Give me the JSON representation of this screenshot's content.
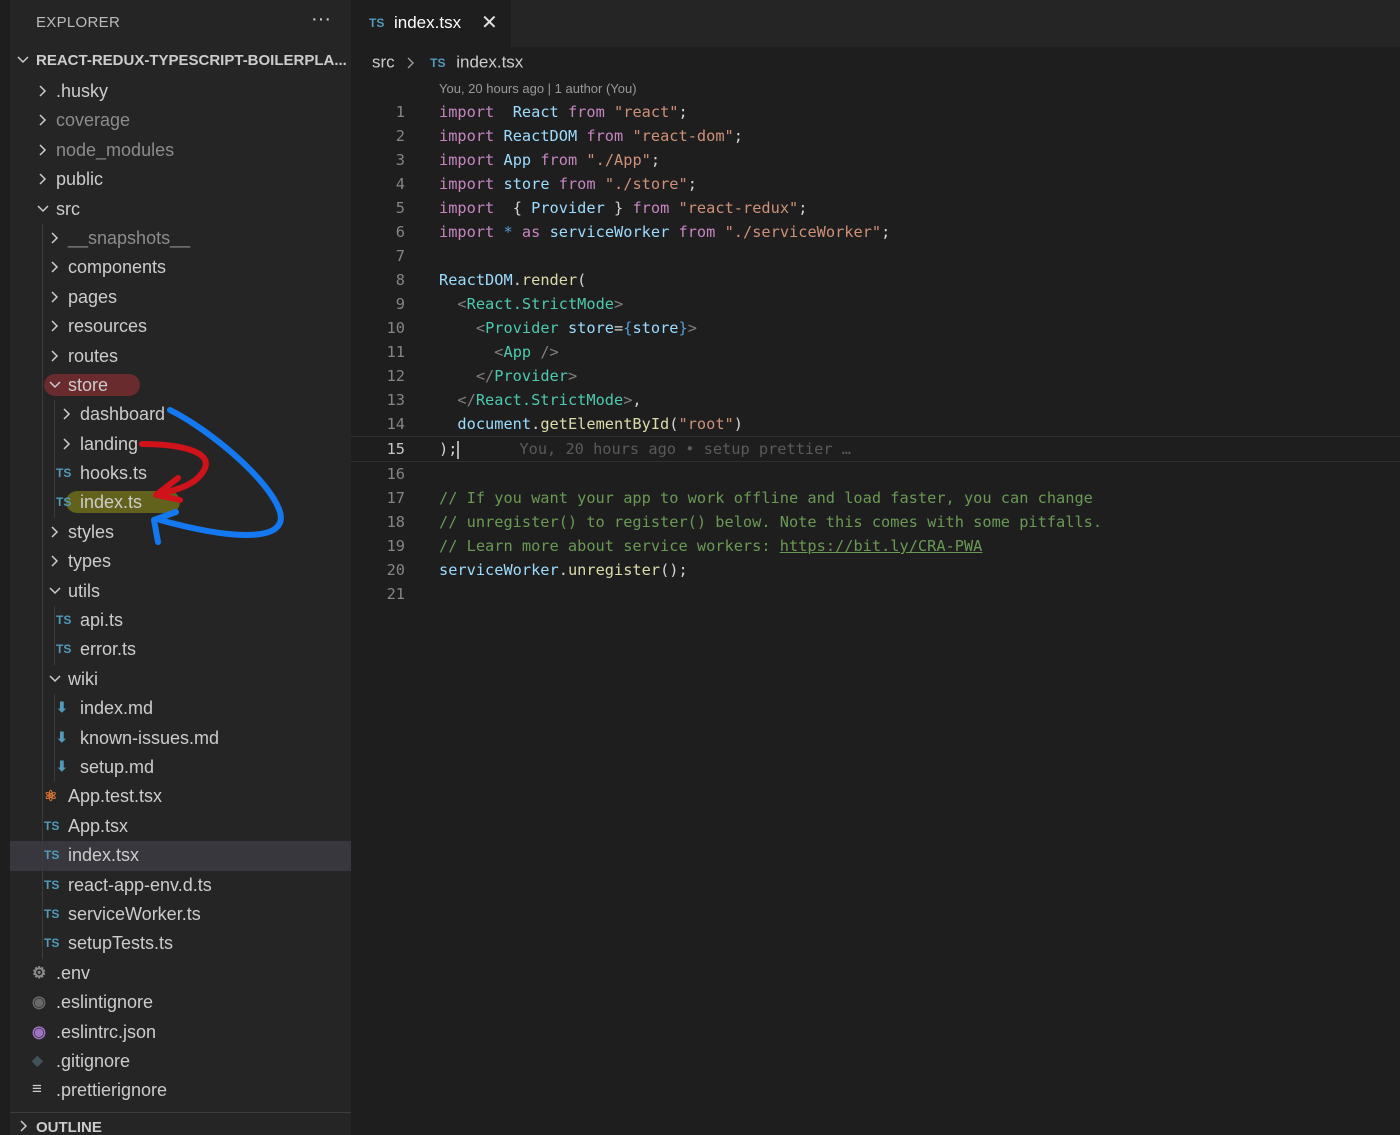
{
  "sidebar": {
    "header": "EXPLORER",
    "more": "···",
    "project": "REACT-REDUX-TYPESCRIPT-BOILERPLA...",
    "outline": "OUTLINE",
    "items": [
      {
        "label": ".husky",
        "level": 0,
        "type": "folder",
        "state": "closed"
      },
      {
        "label": "coverage",
        "level": 0,
        "type": "folder",
        "state": "closed",
        "muted": true
      },
      {
        "label": "node_modules",
        "level": 0,
        "type": "folder",
        "state": "closed",
        "muted": true
      },
      {
        "label": "public",
        "level": 0,
        "type": "folder",
        "state": "closed"
      },
      {
        "label": "src",
        "level": 0,
        "type": "folder",
        "state": "open"
      },
      {
        "label": "__snapshots__",
        "level": 1,
        "type": "folder",
        "state": "closed",
        "muted": true
      },
      {
        "label": "components",
        "level": 1,
        "type": "folder",
        "state": "closed"
      },
      {
        "label": "pages",
        "level": 1,
        "type": "folder",
        "state": "closed"
      },
      {
        "label": "resources",
        "level": 1,
        "type": "folder",
        "state": "closed"
      },
      {
        "label": "routes",
        "level": 1,
        "type": "folder",
        "state": "closed"
      },
      {
        "label": "store",
        "level": 1,
        "type": "folder",
        "state": "open",
        "highlight": "red"
      },
      {
        "label": "dashboard",
        "level": 2,
        "type": "folder",
        "state": "closed"
      },
      {
        "label": "landing",
        "level": 2,
        "type": "folder",
        "state": "closed"
      },
      {
        "label": "hooks.ts",
        "level": 2,
        "type": "ts"
      },
      {
        "label": "index.ts",
        "level": 2,
        "type": "ts",
        "highlight": "olive"
      },
      {
        "label": "styles",
        "level": 1,
        "type": "folder",
        "state": "closed"
      },
      {
        "label": "types",
        "level": 1,
        "type": "folder",
        "state": "closed"
      },
      {
        "label": "utils",
        "level": 1,
        "type": "folder",
        "state": "open"
      },
      {
        "label": "api.ts",
        "level": 2,
        "type": "ts"
      },
      {
        "label": "error.ts",
        "level": 2,
        "type": "ts"
      },
      {
        "label": "wiki",
        "level": 1,
        "type": "folder",
        "state": "open"
      },
      {
        "label": "index.md",
        "level": 2,
        "type": "md"
      },
      {
        "label": "known-issues.md",
        "level": 2,
        "type": "md"
      },
      {
        "label": "setup.md",
        "level": 2,
        "type": "md"
      },
      {
        "label": "App.test.tsx",
        "level": 1,
        "type": "react"
      },
      {
        "label": "App.tsx",
        "level": 1,
        "type": "ts"
      },
      {
        "label": "index.tsx",
        "level": 1,
        "type": "ts",
        "active": true
      },
      {
        "label": "react-app-env.d.ts",
        "level": 1,
        "type": "ts"
      },
      {
        "label": "serviceWorker.ts",
        "level": 1,
        "type": "ts"
      },
      {
        "label": "setupTests.ts",
        "level": 1,
        "type": "ts"
      },
      {
        "label": ".env",
        "level": 0,
        "type": "gear"
      },
      {
        "label": ".eslintignore",
        "level": 0,
        "type": "eslint-gray"
      },
      {
        "label": ".eslintrc.json",
        "level": 0,
        "type": "eslint-purple"
      },
      {
        "label": ".gitignore",
        "level": 0,
        "type": "git"
      },
      {
        "label": ".prettierignore",
        "level": 0,
        "type": "lines"
      }
    ]
  },
  "editor": {
    "tab": {
      "icon": "TS",
      "label": "index.tsx",
      "close": "✕"
    },
    "breadcrumb": {
      "folder": "src",
      "icon": "TS",
      "file": "index.tsx"
    },
    "codelens": "You, 20 hours ago | 1 author (You)",
    "current_line": 15,
    "blame": "You, 20 hours ago • setup prettier …",
    "lines": [
      [
        [
          "kw",
          "import"
        ],
        [
          "",
          "  "
        ],
        [
          "vr",
          "React"
        ],
        [
          "",
          " "
        ],
        [
          "kw",
          "from"
        ],
        [
          "",
          " "
        ],
        [
          "st",
          "\"react\""
        ],
        [
          "",
          ";"
        ]
      ],
      [
        [
          "kw",
          "import"
        ],
        [
          "",
          " "
        ],
        [
          "vr",
          "ReactDOM"
        ],
        [
          "",
          " "
        ],
        [
          "kw",
          "from"
        ],
        [
          "",
          " "
        ],
        [
          "st",
          "\"react-dom\""
        ],
        [
          "",
          ";"
        ]
      ],
      [
        [
          "kw",
          "import"
        ],
        [
          "",
          " "
        ],
        [
          "vr",
          "App"
        ],
        [
          "",
          " "
        ],
        [
          "kw",
          "from"
        ],
        [
          "",
          " "
        ],
        [
          "st",
          "\"./App\""
        ],
        [
          "",
          ";"
        ]
      ],
      [
        [
          "kw",
          "import"
        ],
        [
          "",
          " "
        ],
        [
          "vr",
          "store"
        ],
        [
          "",
          " "
        ],
        [
          "kw",
          "from"
        ],
        [
          "",
          " "
        ],
        [
          "st",
          "\"./store\""
        ],
        [
          "",
          ";"
        ]
      ],
      [
        [
          "kw",
          "import"
        ],
        [
          "",
          "",
          " "
        ],
        [
          "",
          " { "
        ],
        [
          "vr",
          "Provider"
        ],
        [
          "",
          " } "
        ],
        [
          "kw",
          "from"
        ],
        [
          "",
          " "
        ],
        [
          "st",
          "\"react-redux\""
        ],
        [
          "",
          ";"
        ]
      ],
      [
        [
          "kw",
          "import"
        ],
        [
          "",
          " "
        ],
        [
          "bl",
          "*"
        ],
        [
          "",
          " "
        ],
        [
          "kw",
          "as"
        ],
        [
          "",
          " "
        ],
        [
          "vr",
          "serviceWorker"
        ],
        [
          "",
          " "
        ],
        [
          "kw",
          "from"
        ],
        [
          "",
          " "
        ],
        [
          "st",
          "\"./serviceWorker\""
        ],
        [
          "",
          ";"
        ]
      ],
      [],
      [
        [
          "vr",
          "ReactDOM"
        ],
        [
          "",
          "."
        ],
        [
          "fn",
          "render"
        ],
        [
          "",
          "("
        ]
      ],
      [
        [
          "",
          "  "
        ],
        [
          "br",
          "<"
        ],
        [
          "tg",
          "React.StrictMode"
        ],
        [
          "br",
          ">"
        ]
      ],
      [
        [
          "",
          "    "
        ],
        [
          "br",
          "<"
        ],
        [
          "tg",
          "Provider"
        ],
        [
          "",
          " "
        ],
        [
          "vr",
          "store"
        ],
        [
          "",
          "="
        ],
        [
          "bl",
          "{"
        ],
        [
          "vr",
          "store"
        ],
        [
          "bl",
          "}"
        ],
        [
          "br",
          ">"
        ]
      ],
      [
        [
          "",
          "      "
        ],
        [
          "br",
          "<"
        ],
        [
          "tg",
          "App"
        ],
        [
          "",
          " "
        ],
        [
          "br",
          "/>"
        ]
      ],
      [
        [
          "",
          "    "
        ],
        [
          "br",
          "</"
        ],
        [
          "tg",
          "Provider"
        ],
        [
          "br",
          ">"
        ]
      ],
      [
        [
          "",
          "  "
        ],
        [
          "br",
          "</"
        ],
        [
          "tg",
          "React.StrictMode"
        ],
        [
          "br",
          ">"
        ],
        [
          "",
          ","
        ]
      ],
      [
        [
          "",
          "  "
        ],
        [
          "vr",
          "document"
        ],
        [
          "",
          "."
        ],
        [
          "fn",
          "getElementById"
        ],
        [
          "",
          "("
        ],
        [
          "st",
          "\"root\""
        ],
        [
          "",
          ")"
        ]
      ],
      [
        [
          "",
          ");"
        ]
      ],
      [],
      [
        [
          "cm",
          "// If you want your app to work offline and load faster, you can change"
        ]
      ],
      [
        [
          "cm",
          "// unregister() to register() below. Note this comes with some pitfalls."
        ]
      ],
      [
        [
          "cm",
          "// Learn more about service workers: "
        ],
        [
          "cm ul",
          "https://bit.ly/CRA-PWA"
        ]
      ],
      [
        [
          "vr",
          "serviceWorker"
        ],
        [
          "",
          "."
        ],
        [
          "fn",
          "unregister"
        ],
        [
          "",
          "();"
        ]
      ],
      []
    ]
  },
  "colors": {
    "annotation_red": "#d0121b",
    "annotation_blue": "#1479f0",
    "ts_icon": "#519aba"
  }
}
